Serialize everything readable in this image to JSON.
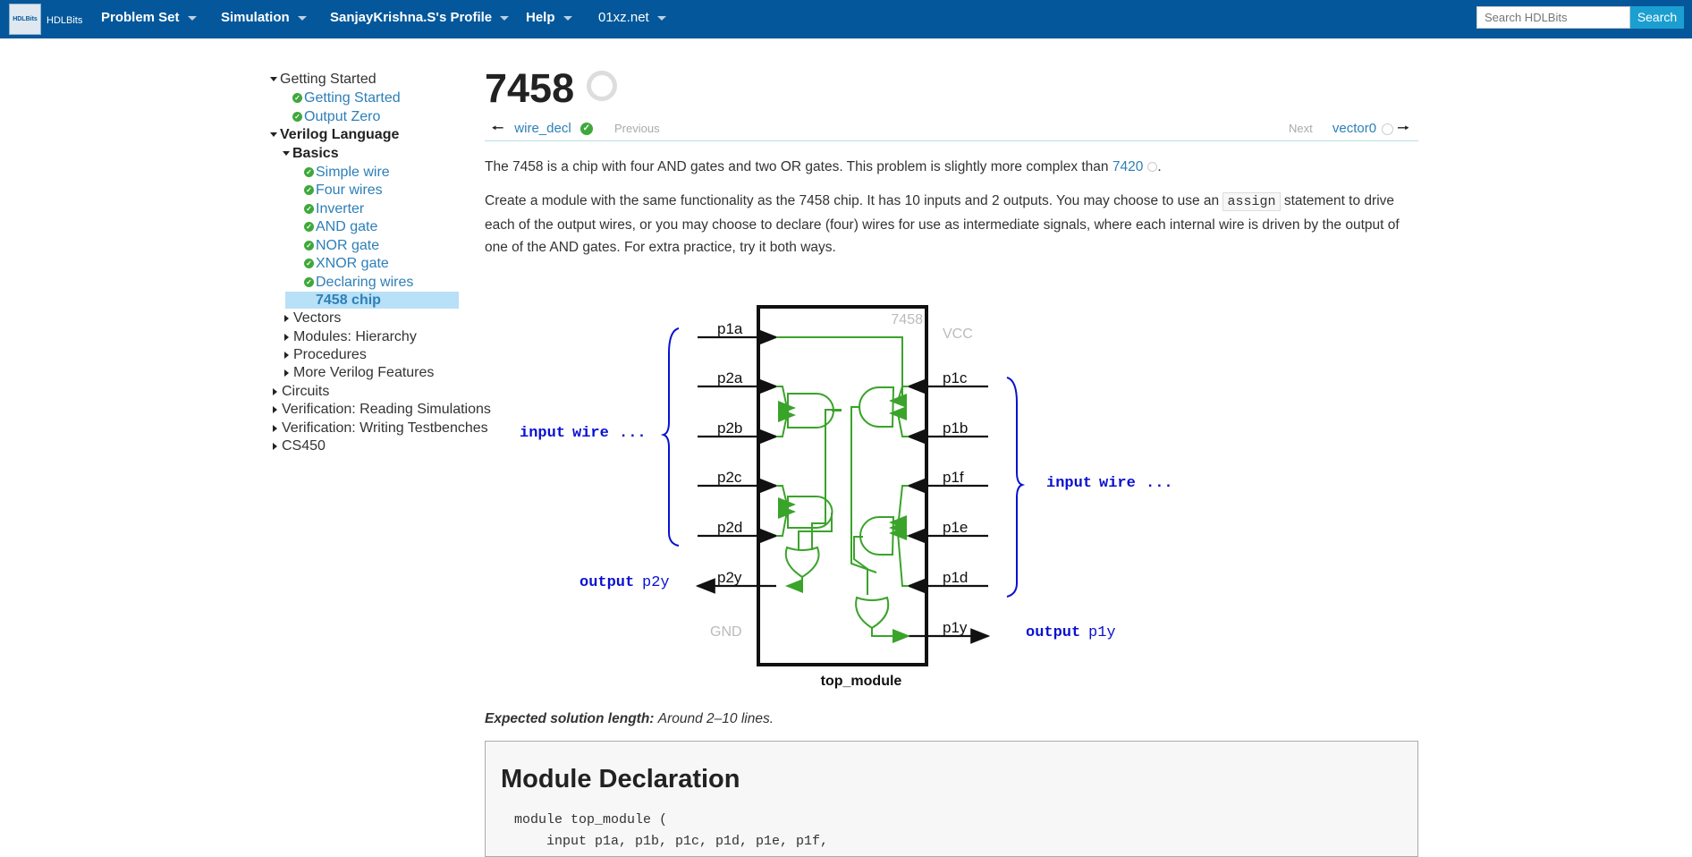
{
  "topnav": {
    "logo_text": "HDLBits",
    "logo_badge": "HDLBits",
    "menu": [
      "Problem Set",
      "Simulation",
      "SanjayKrishna.S's Profile",
      "Help",
      "01xz.net"
    ],
    "search_placeholder": "Search HDLBits",
    "search_button": "Search"
  },
  "sidebar": {
    "getting_started": "Getting Started",
    "gs_items": [
      "Getting Started",
      "Output Zero"
    ],
    "verilog_language": "Verilog Language",
    "basics": "Basics",
    "basics_items": [
      "Simple wire",
      "Four wires",
      "Inverter",
      "AND gate",
      "NOR gate",
      "XNOR gate",
      "Declaring wires"
    ],
    "current": "7458 chip",
    "vl_sections": [
      "Vectors",
      "Modules: Hierarchy",
      "Procedures",
      "More Verilog Features"
    ],
    "top_sections": [
      "Circuits",
      "Verification: Reading Simulations",
      "Verification: Writing Testbenches",
      "CS450"
    ]
  },
  "main": {
    "title": "7458",
    "prev_link": "wire_decl",
    "prev_label": "Previous",
    "next_label": "Next",
    "next_link": "vector0",
    "intro_text": "The 7458 is a chip with four AND gates and two OR gates. This problem is slightly more complex than",
    "intro_link": "7420",
    "intro_end": ".",
    "desc_part1": "Create a module with the same functionality as the 7458 chip. It has 10 inputs and 2 outputs. You may choose to use an",
    "desc_code": "assign",
    "desc_part2": "statement to drive each of the output wires, or you may choose to declare (four) wires for use as intermediate signals, where each internal wire is driven by the output of one of the AND gates. For extra practice, try it both ways.",
    "expected_label": "Expected solution length:",
    "expected_value": "Around 2–10 lines.",
    "module_heading": "Module Declaration",
    "module_code_1": "module top_module (",
    "module_code_2": "    input p1a, p1b, p1c, p1d, p1e, p1f,"
  },
  "diagram": {
    "chip_name": "7458",
    "vcc": "VCC",
    "gnd": "GND",
    "module_name": "top_module",
    "left_pins": [
      "p1a",
      "p2a",
      "p2b",
      "p2c",
      "p2d",
      "p2y"
    ],
    "right_pins": [
      "p1c",
      "p1b",
      "p1f",
      "p1e",
      "p1d",
      "p1y"
    ],
    "input_kw": "input",
    "input_wire": "wire",
    "ellipsis": "...",
    "output_kw": "output",
    "out_left": "p2y",
    "out_right": "p1y",
    "colors": {
      "wire": "#3aa32a",
      "label_blue": "#0a11d0"
    }
  }
}
